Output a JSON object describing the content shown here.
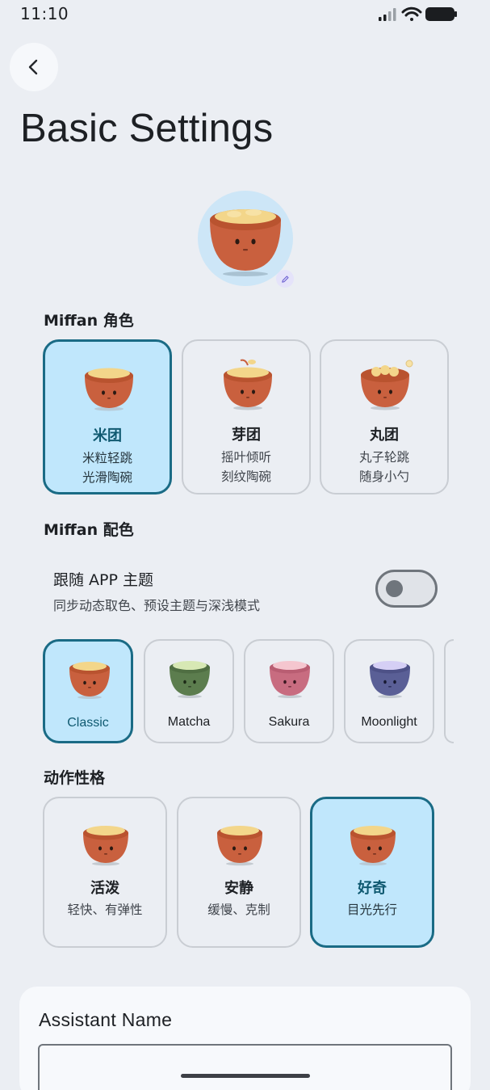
{
  "status_bar": {
    "time": "11:10"
  },
  "page": {
    "title": "Basic Settings"
  },
  "colors": {
    "accent": "#1a6b85",
    "selected_bg": "#c0e7fc",
    "bowl": "#c9603e",
    "rice": "#f3d68a"
  },
  "character_section": {
    "label": "Miffan 角色",
    "items": [
      {
        "name": "米团",
        "line1": "米粒轻跳",
        "line2": "光滑陶碗",
        "selected": true
      },
      {
        "name": "芽团",
        "line1": "摇叶倾听",
        "line2": "刻纹陶碗",
        "selected": false
      },
      {
        "name": "丸团",
        "line1": "丸子轮跳",
        "line2": "随身小勺",
        "selected": false
      }
    ]
  },
  "color_section": {
    "label": "Miffan 配色",
    "follow_app_theme": {
      "title": "跟随 APP 主题",
      "subtitle": "同步动态取色、预设主题与深浅模式",
      "enabled": false
    },
    "themes": [
      {
        "name": "Classic",
        "selected": true
      },
      {
        "name": "Matcha",
        "selected": false
      },
      {
        "name": "Sakura",
        "selected": false
      },
      {
        "name": "Moonlight",
        "selected": false
      }
    ]
  },
  "motion_section": {
    "label": "动作性格",
    "items": [
      {
        "name": "活泼",
        "desc": "轻快、有弹性",
        "selected": false
      },
      {
        "name": "安静",
        "desc": "缓慢、克制",
        "selected": false
      },
      {
        "name": "好奇",
        "desc": "目光先行",
        "selected": true
      }
    ]
  },
  "assistant_name": {
    "label": "Assistant Name",
    "value": ""
  },
  "icons": [
    "back-arrow-icon",
    "edit-pencil-icon",
    "signal-icon",
    "wifi-icon",
    "battery-icon"
  ]
}
